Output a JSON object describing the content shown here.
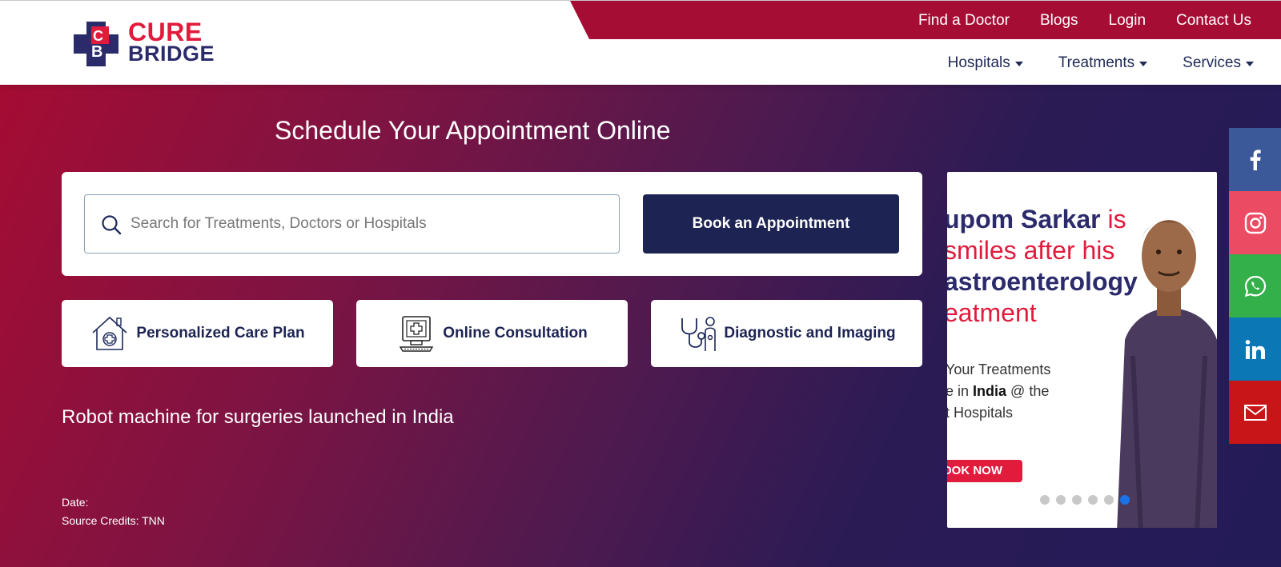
{
  "brand": {
    "line1": "CURE",
    "line2": "BRIDGE",
    "colors": {
      "red": "#e11b3c",
      "navy": "#2b2a6b",
      "topbar": "#a60d35"
    }
  },
  "topnav": [
    "Find a Doctor",
    "Blogs",
    "Login",
    "Contact Us"
  ],
  "mainnav": [
    "Hospitals",
    "Treatments",
    "Services"
  ],
  "hero": {
    "title": "Schedule Your Appointment Online",
    "search_placeholder": "Search for Treatments, Doctors or Hospitals",
    "book_button": "Book an Appointment"
  },
  "features": [
    {
      "label": "Personalized Care Plan",
      "icon": "house-plus-icon"
    },
    {
      "label": "Online Consultation",
      "icon": "computer-medical-icon"
    },
    {
      "label": "Diagnostic and Imaging",
      "icon": "stethoscope-icon"
    }
  ],
  "news": {
    "title": "Robot machine for surgeries launched in India",
    "date_label": "Date:",
    "source_label": "Source Credits: TNN"
  },
  "banner": {
    "head_line1_name": "upom Sarkar",
    "head_line1_rest": " is",
    "head_line2": " smiles after his",
    "head_line3": "astroenterology",
    "head_line4": "eatment",
    "sub_line1": "Your Treatments",
    "sub_line2_pre": "e in ",
    "sub_line2_bold": "India",
    "sub_line2_post": " @ the",
    "sub_line3": "t Hospitals",
    "cta": "OOK NOW",
    "slides_total": 6,
    "active_slide": 6
  },
  "social": [
    "facebook-icon",
    "instagram-icon",
    "whatsapp-icon",
    "linkedin-icon",
    "email-icon"
  ]
}
